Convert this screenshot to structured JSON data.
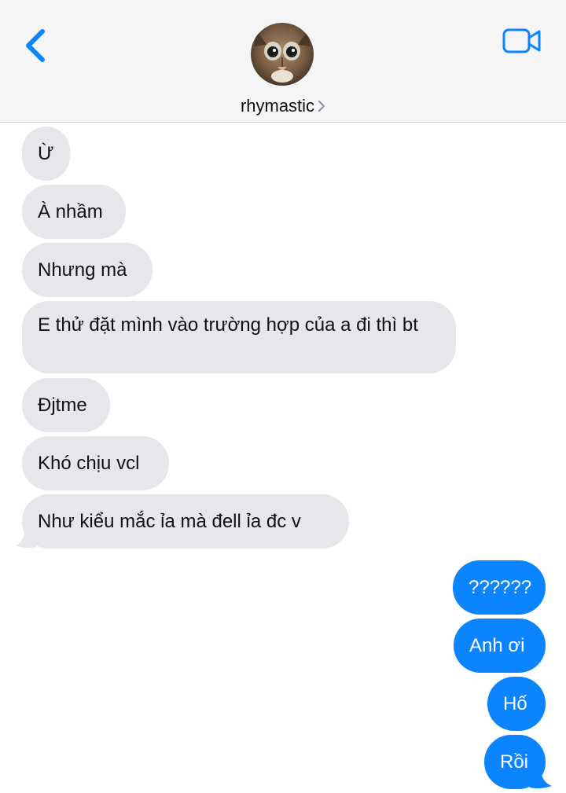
{
  "header": {
    "contact_name": "rhymastic",
    "back_icon": "chevron-left-icon",
    "video_icon": "video-camera-icon",
    "contact_chevron_icon": "chevron-right-icon",
    "accent_color": "#0b84ff"
  },
  "messages": {
    "received": [
      {
        "text": "Ừ"
      },
      {
        "text": "À nhầm"
      },
      {
        "text": "Nhưng mà"
      },
      {
        "text": "E thử đặt mình vào trường hợp của a đi thì bt"
      },
      {
        "text": "Đjtme"
      },
      {
        "text": "Khó chịu vcl"
      },
      {
        "text": "Như kiểu mắc ỉa mà đell ỉa đc v"
      }
    ],
    "sent": [
      {
        "text": "??????"
      },
      {
        "text": "Anh ơi"
      },
      {
        "text": "Hố"
      },
      {
        "text": "Rồi"
      }
    ]
  },
  "colors": {
    "received_bubble": "#e6e6eb",
    "sent_bubble": "#0b84ff"
  }
}
